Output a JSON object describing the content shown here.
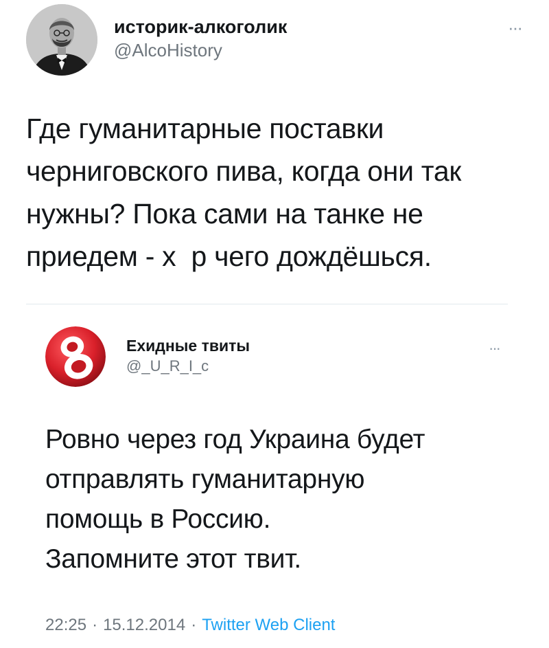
{
  "tweet": {
    "author": {
      "display_name": "историк-алкоголик",
      "handle": "@AlcoHistory",
      "avatar_icon": "portrait-avatar-icon"
    },
    "more_icon": "more-options-icon",
    "more_label": "···",
    "text": "Где гуманитарные поставки\nчерниговского пива, когда они так\nнужны? Пока сами на танке не\nприедем - х  р чего дождёшься."
  },
  "quoted_tweet": {
    "author": {
      "display_name": "Ехидные твиты",
      "handle": "@_U_R_I_c",
      "avatar_icon": "number-eight-logo-icon"
    },
    "more_label": "···",
    "text": "Ровно через год Украина будет\nотправлять гуманитарную\nпомощь в Россию.\nЗапомните этот твит.",
    "time": "22:25",
    "date": "15.12.2014",
    "separator": "·",
    "source": "Twitter Web Client"
  },
  "colors": {
    "text": "#14171a",
    "secondary": "#6e767d",
    "link": "#1da1f2",
    "divider": "#e1e8ed",
    "logo_red": "#d9202a"
  }
}
